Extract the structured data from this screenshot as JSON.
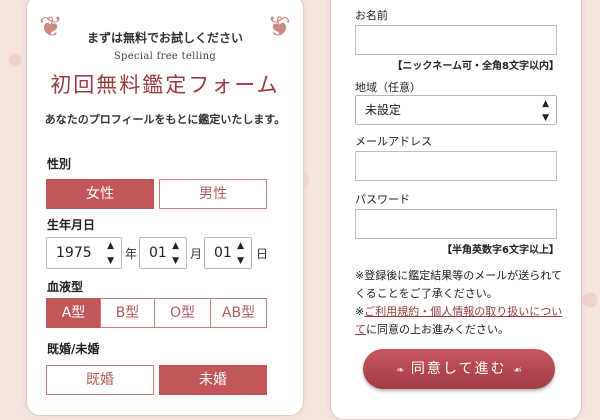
{
  "left_form": {
    "small_title": "まずは無料でお試しください",
    "subtitle": "Special free telling",
    "title": "初回無料鑑定フォーム",
    "intro": "あなたのプロフィールをもとに鑑定いたします。",
    "gender": {
      "label": "性別",
      "options": [
        "女性",
        "男性"
      ],
      "selected": "女性"
    },
    "birthdate": {
      "label": "生年月日",
      "year": "1975",
      "year_unit": "年",
      "month": "01",
      "month_unit": "月",
      "day": "01",
      "day_unit": "日"
    },
    "blood_type": {
      "label": "血液型",
      "options": [
        "A型",
        "B型",
        "O型",
        "AB型"
      ],
      "selected": "A型"
    },
    "marital": {
      "label": "既婚/未婚",
      "options": [
        "既婚",
        "未婚"
      ],
      "selected": "未婚"
    }
  },
  "right_form": {
    "name": {
      "label": "お名前",
      "value": "",
      "note": "【ニックネーム可・全角8文字以内】"
    },
    "region": {
      "label": "地域（任意）",
      "value": "未設定"
    },
    "email": {
      "label": "メールアドレス",
      "value": ""
    },
    "password": {
      "label": "パスワード",
      "value": "",
      "note": "【半角英数字6文字以上】"
    },
    "notice_1": "※登録後に鑑定結果等のメールが送られて",
    "notice_2": "くることをご了承ください。",
    "notice_3_prefix": "※",
    "terms_link_1": "ご利用規約・個人情報の取り扱いについ",
    "terms_link_2": "て",
    "notice_3_suffix": "に同意の上お進みください。",
    "submit_label": "同意して進む"
  },
  "colors": {
    "accent": "#c2565a",
    "title": "#9a3b3f",
    "background": "#f6e4df"
  }
}
